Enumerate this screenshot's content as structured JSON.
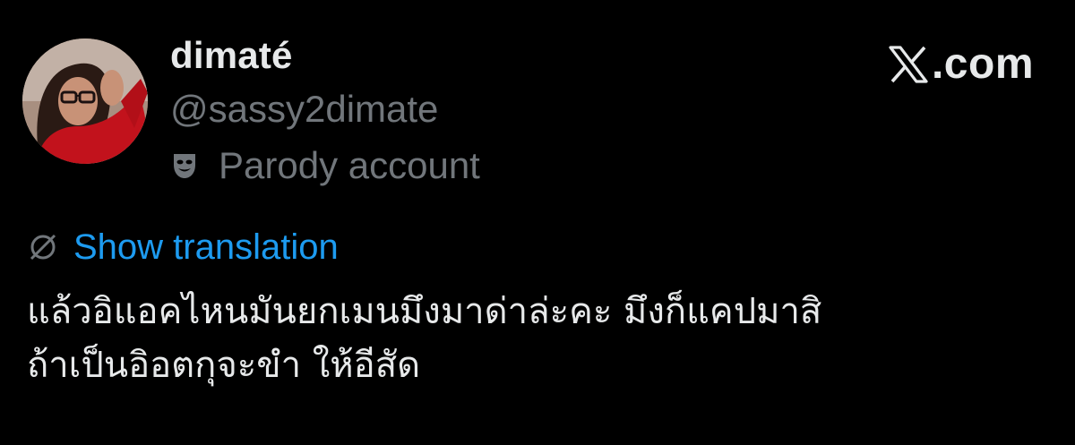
{
  "author": {
    "display_name": "dimaté",
    "handle": "@sassy2dimate",
    "badge_label": "Parody account",
    "badge_icon": "theater-mask-icon",
    "avatar": "profile-photo-avatar"
  },
  "brand": {
    "logo_icon": "x-logo-icon",
    "text": ".com"
  },
  "post": {
    "translate_label": "Show translation",
    "translate_icon": "globe-icon",
    "lines": [
      "แล้วอิแอคไหนมันยกเมนมึงมาด่าล่ะคะ มึงก็แคปมาสิ",
      "ถ้าเป็นอิอตกุจะขำ ให้อีสัด"
    ]
  },
  "colors": {
    "background": "#000000",
    "primary_text": "#e7e9ea",
    "secondary_text": "#71767b",
    "link": "#1d9bf0"
  }
}
